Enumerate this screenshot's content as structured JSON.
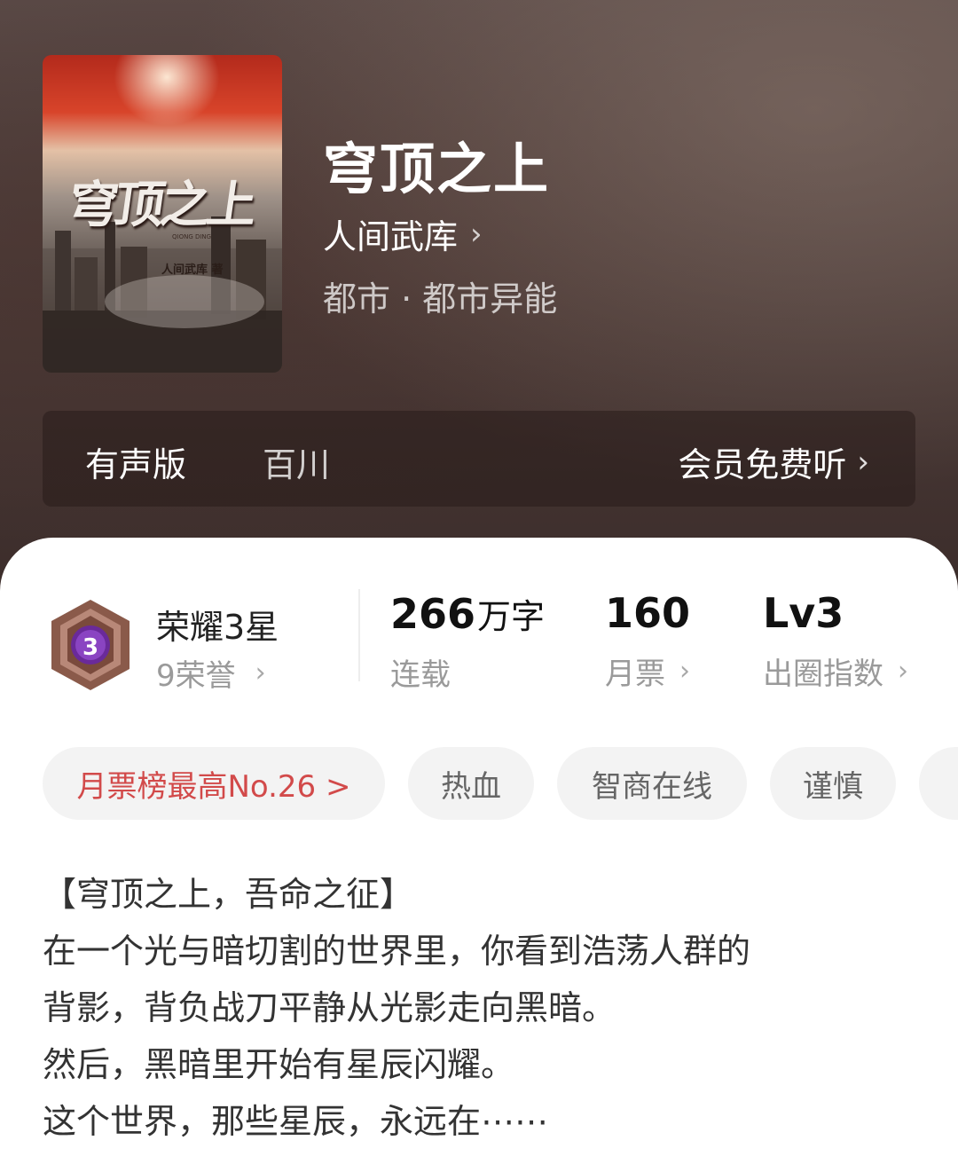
{
  "book": {
    "title": "穹顶之上",
    "author": "人间武库",
    "genre": "都市 · 都市异能",
    "cover": {
      "title": "穹顶之上",
      "subtitle": "QIONG DING",
      "author": "人间武库 著"
    }
  },
  "audio": {
    "label": "有声版",
    "narrator": "百川",
    "cta": "会员免费听"
  },
  "honor": {
    "badge_level": "3",
    "title": "荣耀3星",
    "count": "9荣誉"
  },
  "stats": [
    {
      "value": "266",
      "unit": "万字",
      "label": "连载"
    },
    {
      "value": "160",
      "unit": "",
      "label": "月票"
    },
    {
      "value": "Lv3",
      "unit": "",
      "label": "出圈指数"
    }
  ],
  "tags": [
    "月票榜最高No.26 >",
    "热血",
    "智商在线",
    "谨慎"
  ],
  "description": [
    "【穹顶之上，吾命之征】",
    "在一个光与暗切割的世界里，你看到浩荡人群的",
    "背影，背负战刀平静从光影走向黑暗。",
    "然后，黑暗里开始有星辰闪耀。",
    "这个世界，那些星辰，永远在⋯⋯"
  ],
  "colors": {
    "hero_bg": "#4a3a37",
    "rank_tag": "#d24a4a",
    "badge_purple": "#6a2a9a",
    "badge_bronze": "#8a5a4a"
  },
  "icons": {
    "chevron": "chevron-right-icon",
    "badge": "honor-badge-icon"
  }
}
